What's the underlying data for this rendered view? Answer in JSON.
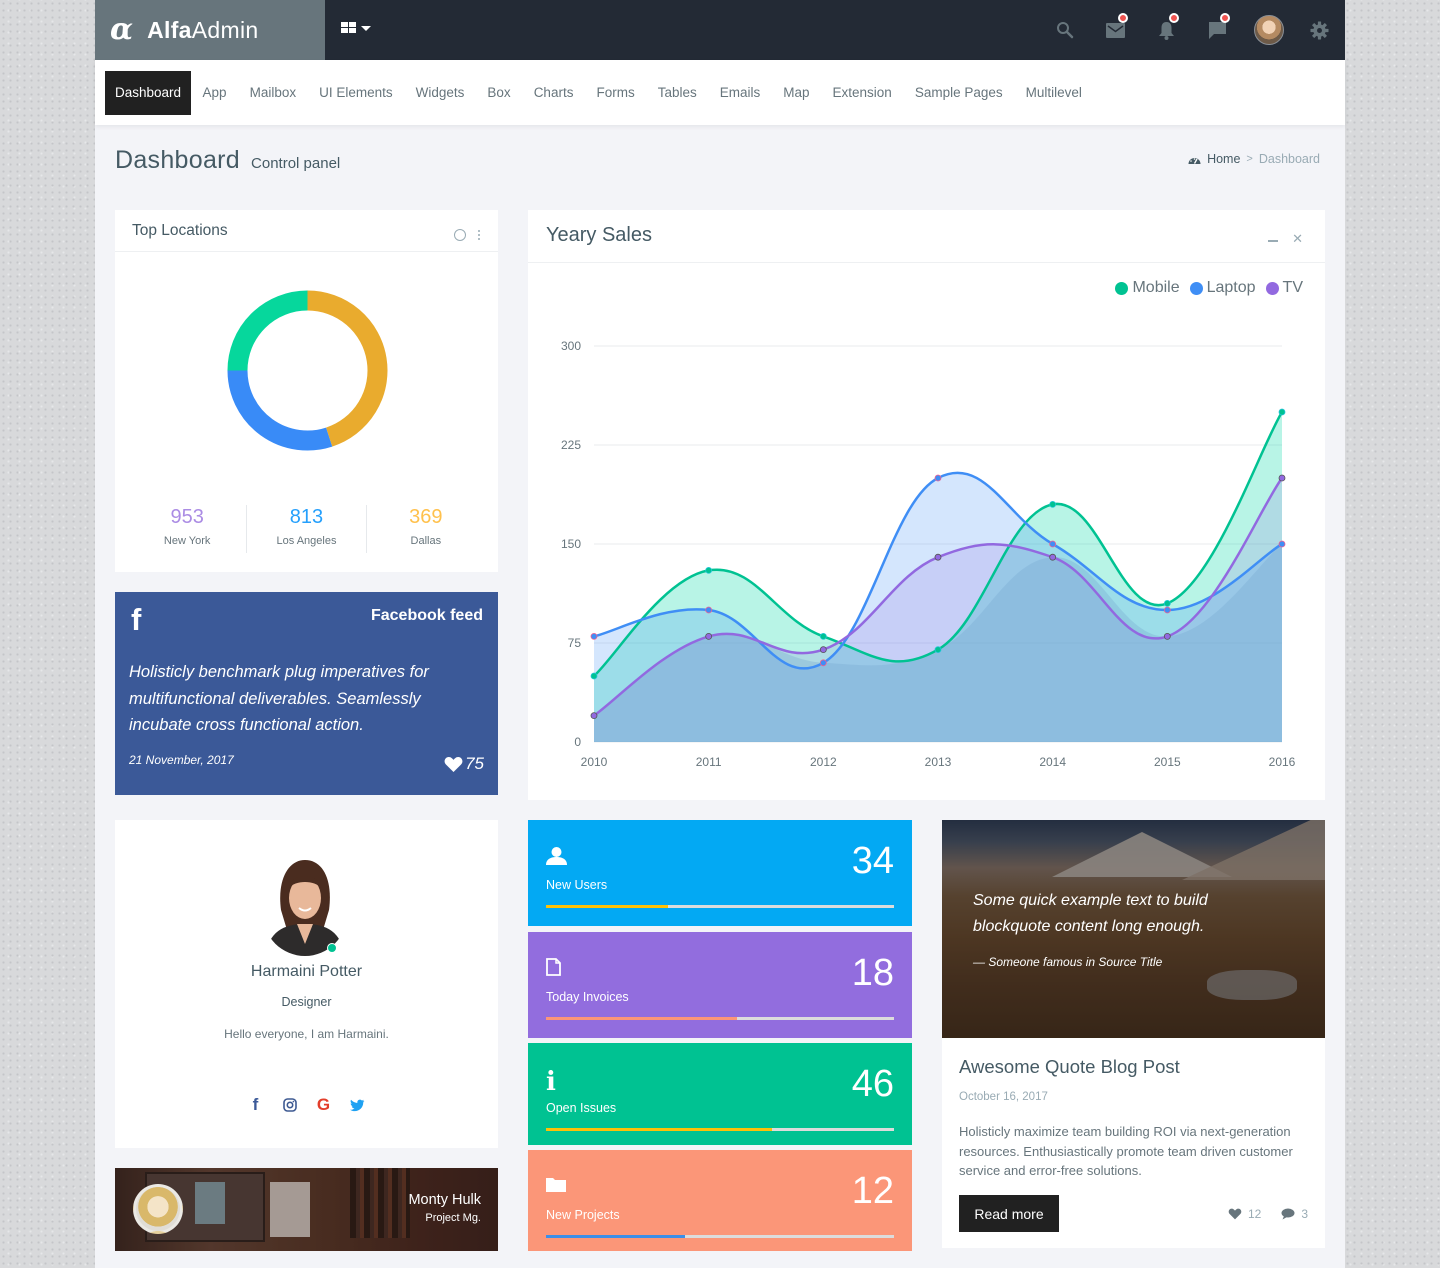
{
  "brand": {
    "name_bold": "Alfa",
    "name_light": "Admin",
    "logo_icon": "alpha-icon"
  },
  "topbar": {
    "icons": [
      {
        "name": "search-icon",
        "badge": false
      },
      {
        "name": "mail-icon",
        "badge": true
      },
      {
        "name": "bell-icon",
        "badge": true
      },
      {
        "name": "chat-icon",
        "badge": true
      },
      {
        "name": "user-avatar",
        "badge": false
      },
      {
        "name": "gear-icon",
        "badge": false
      }
    ],
    "badge_color": "#ef5350"
  },
  "nav": {
    "items": [
      "Dashboard",
      "App",
      "Mailbox",
      "UI Elements",
      "Widgets",
      "Box",
      "Charts",
      "Forms",
      "Tables",
      "Emails",
      "Map",
      "Extension",
      "Sample Pages",
      "Multilevel"
    ],
    "active": "Dashboard"
  },
  "page": {
    "title": "Dashboard",
    "subtitle": "Control panel",
    "breadcrumb": {
      "home": "Home",
      "separator": ">",
      "current": "Dashboard"
    }
  },
  "top_locations": {
    "title": "Top Locations",
    "donut": [
      {
        "label": "Dallas-segment",
        "value": 45,
        "color": "#e9ab2e"
      },
      {
        "label": "Los Angeles-segment",
        "value": 30,
        "color": "#398bf7"
      },
      {
        "label": "New York-segment",
        "value": 25,
        "color": "#06d79c"
      }
    ],
    "stats": [
      {
        "value": "953",
        "label": "New York",
        "color": "#ab8ce4"
      },
      {
        "value": "813",
        "label": "Los Angeles",
        "color": "#26a0fc"
      },
      {
        "value": "369",
        "label": "Dallas",
        "color": "#ffc14d"
      }
    ]
  },
  "facebook": {
    "icon": "f",
    "title": "Facebook feed",
    "text": "Holisticly benchmark plug imperatives for multifunctional deliverables. Seamlessly incubate cross functional action.",
    "date": "21 November, 2017",
    "likes": "75",
    "bg": "#3b5998"
  },
  "profile": {
    "name": "Harmaini Potter",
    "role": "Designer",
    "bio": "Hello everyone, I am Harmaini.",
    "status": "online",
    "socials": [
      "facebook",
      "instagram",
      "google",
      "twitter"
    ]
  },
  "monty": {
    "name": "Monty Hulk",
    "role": "Project Mg."
  },
  "chart_data": {
    "type": "area",
    "title": "Yeary Sales",
    "x": [
      "2010",
      "2011",
      "2012",
      "2013",
      "2014",
      "2015",
      "2016"
    ],
    "series": [
      {
        "name": "Mobile",
        "color": "#00c292",
        "fill": "rgba(0,214,166,0.28)",
        "values": [
          50,
          130,
          80,
          70,
          180,
          105,
          250
        ]
      },
      {
        "name": "Laptop",
        "color": "#3f8ef5",
        "fill": "rgba(61,142,245,0.22)",
        "values": [
          80,
          100,
          60,
          200,
          150,
          100,
          150
        ]
      },
      {
        "name": "TV",
        "color": "#9269e0",
        "fill": "rgba(146,105,224,0.18)",
        "values": [
          20,
          80,
          70,
          140,
          140,
          80,
          200
        ]
      }
    ],
    "yticks": [
      0,
      75,
      150,
      225,
      300
    ],
    "ylim": [
      0,
      300
    ],
    "xlabel": "",
    "ylabel": "",
    "grid": true,
    "legend": "top-right",
    "area_base_color": "#abcfe8"
  },
  "tiles": [
    {
      "label": "New Users",
      "value": "34",
      "icon": "user-icon",
      "bg": "#03a9f3",
      "bar_color": "#fec107",
      "progress": 35
    },
    {
      "label": "Today Invoices",
      "value": "18",
      "icon": "file-icon",
      "bg": "#926dde",
      "bar_color": "#fb9678",
      "progress": 55
    },
    {
      "label": "Open Issues",
      "value": "46",
      "icon": "info-icon",
      "bg": "#00c292",
      "bar_color": "#fec107",
      "progress": 65
    },
    {
      "label": "New Projects",
      "value": "12",
      "icon": "folder-icon",
      "bg": "#fb9678",
      "bar_color": "#3b8ee8",
      "progress": 40
    }
  ],
  "blog": {
    "quote": "Some quick example text to build blockquote content long enough.",
    "source": "— Someone famous in Source Title",
    "title": "Awesome Quote Blog Post",
    "date": "October 16, 2017",
    "text": "Holisticly maximize team building ROI via next-generation resources. Enthusiastically promote team driven customer service and error-free solutions.",
    "read_more": "Read more",
    "likes": "12",
    "comments": "3"
  }
}
